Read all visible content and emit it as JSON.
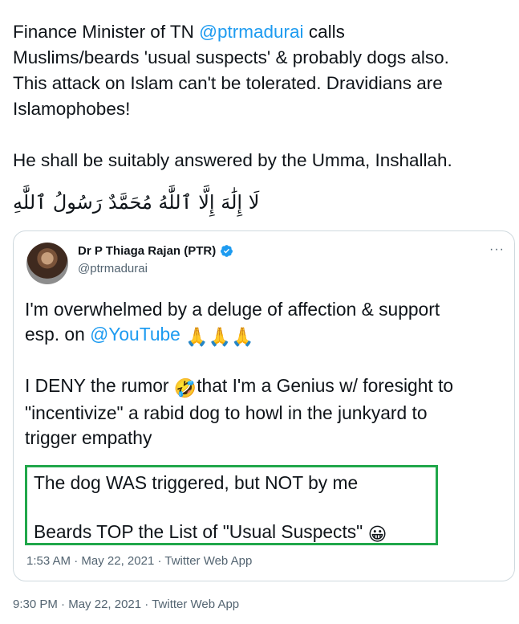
{
  "tweet": {
    "line1_before": "Finance Minister of TN ",
    "line1_mention": "@ptrmadurai",
    "line1_after": " calls",
    "line2": "Muslims/beards 'usual suspects' & probably dogs also.",
    "line3": "This attack on Islam can't be tolerated. Dravidians are",
    "line4": "Islamophobes!",
    "line5": "He shall be suitably answered by the Umma, Inshallah.",
    "arabic": "لَا إِلَٰهَ إِلَّا ٱللَّٰهُ مُحَمَّدٌ رَسُولُ ٱللَّٰهِ",
    "time": "9:30 PM",
    "date": "May 22, 2021",
    "source": "Twitter Web App",
    "separator": " · "
  },
  "quote": {
    "author_name": "Dr P Thiaga Rajan (PTR)",
    "handle": "@ptrmadurai",
    "more": "···",
    "line1": "I'm overwhelmed by a deluge of affection & support",
    "line2_before": "esp. on ",
    "line2_mention": "@YouTube",
    "line2_emoji": "🙏🙏🙏",
    "line3_before": "I DENY the rumor ",
    "line3_emoji": "🤣",
    "line3_after": "that I'm a Genius w/ foresight to",
    "line4": "\"incentivize\" a rabid dog to howl in the junkyard to",
    "line5": "trigger empathy",
    "highlight_line1": "The dog WAS triggered, but NOT by me",
    "highlight_line2": "Beards TOP the List of \"Usual Suspects\" ",
    "highlight_emoji": "😀",
    "time": "1:53 AM",
    "date": "May 22, 2021",
    "source": "Twitter Web App",
    "separator": " · "
  },
  "colors": {
    "mention": "#1d9bf0",
    "highlight_border": "#20a74a",
    "meta_text": "#536471"
  }
}
